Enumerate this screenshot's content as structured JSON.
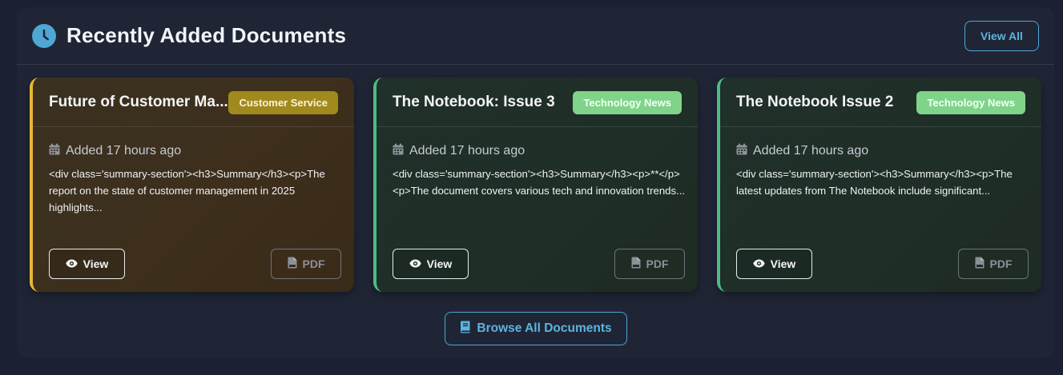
{
  "header": {
    "title": "Recently Added Documents",
    "icon": "clock-icon",
    "view_all_label": "View All"
  },
  "cards": [
    {
      "title": "Future of Customer Ma...",
      "category": "Customer Service",
      "category_color": "#a08a1e",
      "accent": "#e6b732",
      "date": "Added 17 hours ago",
      "summary": "<div class='summary-section'><h3>Summary</h3><p>The report on the state of customer management in 2025 highlights...",
      "view_label": "View",
      "pdf_label": "PDF"
    },
    {
      "title": "The Notebook: Issue 3",
      "category": "Technology News",
      "category_color": "#7fd48a",
      "accent": "#4dbb84",
      "date": "Added 17 hours ago",
      "summary": "<div class='summary-section'><h3>Summary</h3><p>**</p><p>The document covers various tech and innovation trends...",
      "view_label": "View",
      "pdf_label": "PDF"
    },
    {
      "title": "The Notebook Issue 2",
      "category": "Technology News",
      "category_color": "#7fd48a",
      "accent": "#4dbb84",
      "date": "Added 17 hours ago",
      "summary": "<div class='summary-section'><h3>Summary</h3><p>The latest updates from The Notebook include significant...",
      "view_label": "View",
      "pdf_label": "PDF"
    }
  ],
  "footer": {
    "browse_label": "Browse All Documents",
    "browse_icon": "book-icon"
  }
}
